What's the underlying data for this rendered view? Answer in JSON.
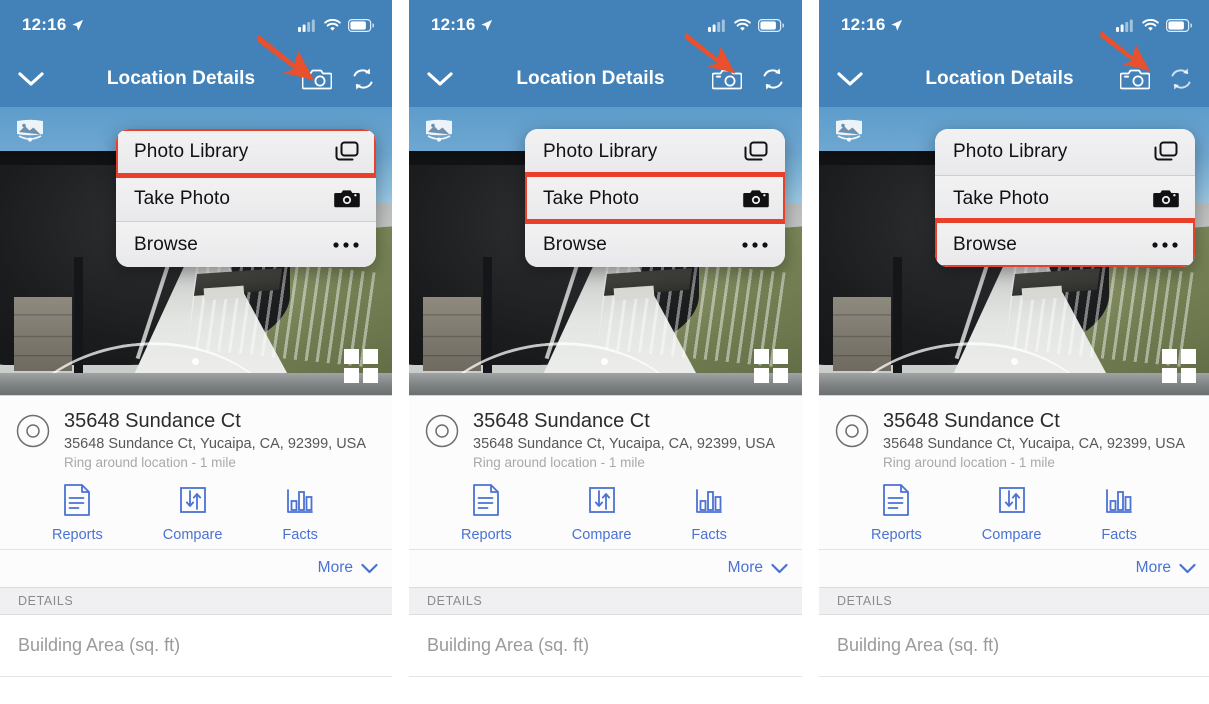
{
  "panels": [
    {
      "status": {
        "time": "12:16",
        "location_icon": "location-arrow-icon",
        "signal_icon": "cellular-signal-icon",
        "wifi_icon": "wifi-icon",
        "battery_icon": "battery-icon"
      },
      "nav": {
        "back_icon": "chevron-down-icon",
        "title": "Location Details",
        "camera_icon": "camera-icon",
        "refresh_icon": "refresh-sync-icon"
      },
      "annotation": {
        "arrow_icon": "red-pointer-arrow",
        "points_at": "camera-icon",
        "color": "#e8502e"
      },
      "photo": {
        "pano_icon": "panorama-view-icon",
        "grid_icon": "grid-view-icon"
      },
      "menu": {
        "highlight_color": "#e8402a",
        "items": [
          {
            "label": "Photo Library",
            "icon": "photo-stack-icon",
            "highlighted": true
          },
          {
            "label": "Take Photo",
            "icon": "camera-icon",
            "highlighted": false
          },
          {
            "label": "Browse",
            "icon": "ellipsis-icon",
            "highlighted": false
          }
        ]
      },
      "info": {
        "marker_icon": "location-ring-icon",
        "title": "35648 Sundance Ct",
        "subtitle": "35648 Sundance Ct, Yucaipa, CA, 92399, USA",
        "note": "Ring around location - 1 mile",
        "actions": [
          {
            "label": "Reports",
            "icon": "document-icon"
          },
          {
            "label": "Compare",
            "icon": "compare-arrows-icon"
          },
          {
            "label": "Facts",
            "icon": "bar-chart-icon"
          }
        ],
        "more_label": "More",
        "more_icon": "chevron-down-icon"
      },
      "details": {
        "header": "DETAILS",
        "rows": [
          {
            "label": "Building Area (sq. ft)"
          }
        ]
      }
    },
    {
      "status": {
        "time": "12:16",
        "location_icon": "location-arrow-icon",
        "signal_icon": "cellular-signal-icon",
        "wifi_icon": "wifi-icon",
        "battery_icon": "battery-icon"
      },
      "nav": {
        "back_icon": "chevron-down-icon",
        "title": "Location Details",
        "camera_icon": "camera-icon",
        "refresh_icon": "refresh-sync-icon"
      },
      "annotation": {
        "arrow_icon": "red-pointer-arrow",
        "points_at": "camera-icon",
        "color": "#e8502e"
      },
      "photo": {
        "pano_icon": "panorama-view-icon",
        "grid_icon": "grid-view-icon"
      },
      "menu": {
        "highlight_color": "#e8402a",
        "items": [
          {
            "label": "Photo Library",
            "icon": "photo-stack-icon",
            "highlighted": false
          },
          {
            "label": "Take Photo",
            "icon": "camera-icon",
            "highlighted": true
          },
          {
            "label": "Browse",
            "icon": "ellipsis-icon",
            "highlighted": false
          }
        ]
      },
      "info": {
        "marker_icon": "location-ring-icon",
        "title": "35648 Sundance Ct",
        "subtitle": "35648 Sundance Ct, Yucaipa, CA, 92399, USA",
        "note": "Ring around location - 1 mile",
        "actions": [
          {
            "label": "Reports",
            "icon": "document-icon"
          },
          {
            "label": "Compare",
            "icon": "compare-arrows-icon"
          },
          {
            "label": "Facts",
            "icon": "bar-chart-icon"
          }
        ],
        "more_label": "More",
        "more_icon": "chevron-down-icon"
      },
      "details": {
        "header": "DETAILS",
        "rows": [
          {
            "label": "Building Area (sq. ft)"
          }
        ]
      }
    },
    {
      "status": {
        "time": "12:16",
        "location_icon": "location-arrow-icon",
        "signal_icon": "cellular-signal-icon",
        "wifi_icon": "wifi-icon",
        "battery_icon": "battery-icon"
      },
      "nav": {
        "back_icon": "chevron-down-icon",
        "title": "Location Details",
        "camera_icon": "camera-icon",
        "refresh_icon": "refresh-sync-icon"
      },
      "annotation": {
        "arrow_icon": "red-pointer-arrow",
        "points_at": "camera-icon",
        "color": "#e8502e"
      },
      "photo": {
        "pano_icon": "panorama-view-icon",
        "grid_icon": "grid-view-icon"
      },
      "menu": {
        "highlight_color": "#e8402a",
        "items": [
          {
            "label": "Photo Library",
            "icon": "photo-stack-icon",
            "highlighted": false
          },
          {
            "label": "Take Photo",
            "icon": "camera-icon",
            "highlighted": false
          },
          {
            "label": "Browse",
            "icon": "ellipsis-icon",
            "highlighted": true
          }
        ]
      },
      "info": {
        "marker_icon": "location-ring-icon",
        "title": "35648 Sundance Ct",
        "subtitle": "35648 Sundance Ct, Yucaipa, CA, 92399, USA",
        "note": "Ring around location - 1 mile",
        "actions": [
          {
            "label": "Reports",
            "icon": "document-icon"
          },
          {
            "label": "Compare",
            "icon": "compare-arrows-icon"
          },
          {
            "label": "Facts",
            "icon": "bar-chart-icon"
          }
        ],
        "more_label": "More",
        "more_icon": "chevron-down-icon"
      },
      "details": {
        "header": "DETAILS",
        "rows": [
          {
            "label": "Building Area (sq. ft)"
          }
        ]
      }
    }
  ],
  "theme": {
    "header_blue": "#4282b8",
    "accent_blue": "#4a72d4",
    "annotation_red": "#e8402a"
  }
}
